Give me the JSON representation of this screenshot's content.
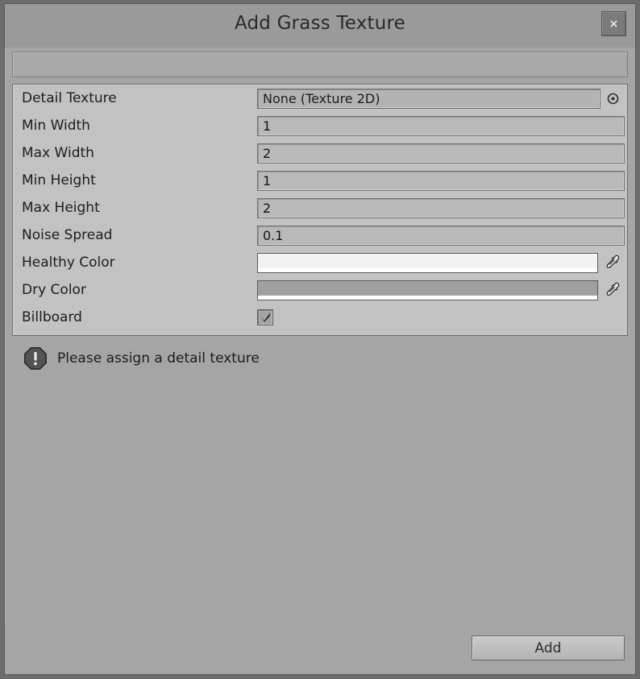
{
  "window": {
    "title": "Add Grass Texture",
    "close_label": "×"
  },
  "properties": [
    {
      "label": "Detail Texture",
      "type": "object",
      "value": "None (Texture 2D)",
      "picker_icon": "object-picker-icon"
    },
    {
      "label": "Min Width",
      "type": "number",
      "value": "1"
    },
    {
      "label": "Max Width",
      "type": "number",
      "value": "2"
    },
    {
      "label": "Min Height",
      "type": "number",
      "value": "1"
    },
    {
      "label": "Max Height",
      "type": "number",
      "value": "2"
    },
    {
      "label": "Noise Spread",
      "type": "number",
      "value": "0.1"
    },
    {
      "label": "Healthy Color",
      "type": "color",
      "color": "#f2f2f2",
      "alpha_color": "#ffffff",
      "eyedropper_icon": "eyedropper-icon"
    },
    {
      "label": "Dry Color",
      "type": "color",
      "color": "#a0a0a0",
      "alpha_color": "#ffffff",
      "eyedropper_icon": "eyedropper-icon"
    },
    {
      "label": "Billboard",
      "type": "checkbox",
      "checked": true
    }
  ],
  "message": {
    "icon": "warning-icon",
    "text": "Please assign a detail texture"
  },
  "footer": {
    "add_label": "Add"
  },
  "colors": {
    "window_bg": "#6c6c6c",
    "panel_bg": "#c2c2c2",
    "body_bg": "#a5a5a5",
    "titlebar_bg": "#9a9a9a",
    "text": "#1d1d1d"
  }
}
